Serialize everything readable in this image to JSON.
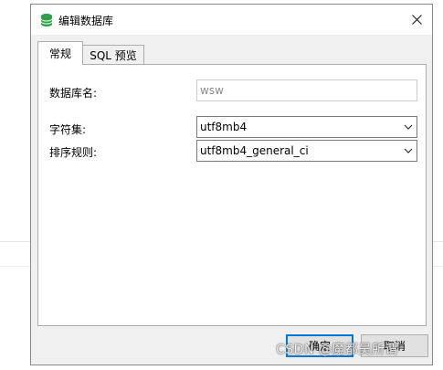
{
  "dialog": {
    "title": "编辑数据库",
    "icon": "database-icon",
    "icon_color": "#2ea04a"
  },
  "tabs": [
    {
      "label": "常规",
      "active": true
    },
    {
      "label": "SQL 预览",
      "active": false
    }
  ],
  "form": {
    "db_name_label": "数据库名:",
    "db_name_value": "wsw",
    "charset_label": "字符集:",
    "charset_value": "utf8mb4",
    "collation_label": "排序规则:",
    "collation_value": "utf8mb4_general_ci"
  },
  "buttons": {
    "ok": "确定",
    "cancel": "取消"
  },
  "watermark": "CSDN @魔都吴所谓"
}
